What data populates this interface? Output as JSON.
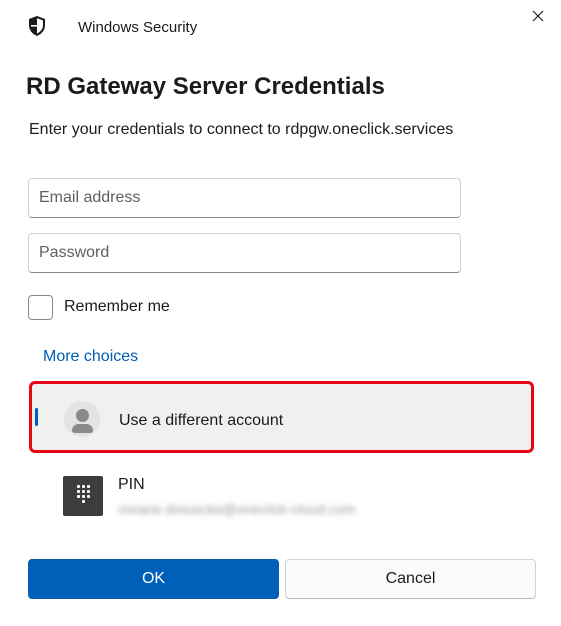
{
  "window": {
    "app_title": "Windows Security",
    "app_icon": "shield-icon",
    "close_icon": "close-icon"
  },
  "dialog": {
    "heading": "RD Gateway Server Credentials",
    "subtext": "Enter your credentials to connect to rdpgw.oneclick.services"
  },
  "form": {
    "email": {
      "value": "",
      "placeholder": "Email address"
    },
    "password": {
      "value": "",
      "placeholder": "Password"
    },
    "remember": {
      "label": "Remember me",
      "checked": false
    }
  },
  "more_choices": {
    "link_label": "More choices",
    "options": [
      {
        "label": "Use a different account",
        "icon": "person-icon",
        "selected": true
      },
      {
        "label": "PIN",
        "icon": "keypad-icon",
        "detail": "viviane.dreuscke@oneclick-cloud.com"
      }
    ]
  },
  "buttons": {
    "ok_label": "OK",
    "cancel_label": "Cancel"
  },
  "colors": {
    "accent": "#005fb8",
    "highlight_border": "#e30613",
    "selected_background": "#f0f0f0"
  }
}
